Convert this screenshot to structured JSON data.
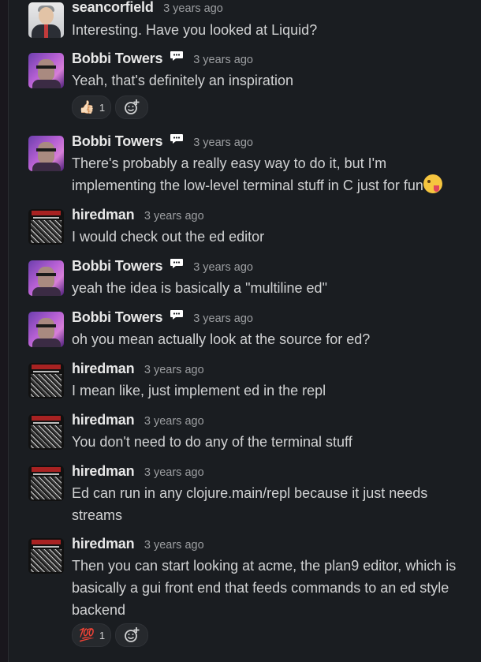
{
  "messages": [
    {
      "author": "seancorfield",
      "time": "3 years ago",
      "text": "Interesting. Have you looked at Liquid?",
      "avatar": "seancorfield-avatar"
    },
    {
      "author": "Bobbi Towers",
      "time": "3 years ago",
      "text": "Yeah, that's definitely an inspiration",
      "status_icon": "speech-bubble-icon",
      "reactions": [
        {
          "emoji": "👍🏻",
          "icon": "thumbs-up-icon",
          "count": "1"
        }
      ]
    },
    {
      "author": "Bobbi Towers",
      "time": "3 years ago",
      "text": "There's probably a really easy way to do it, but I'm implementing the low-level terminal stuff in C just for fun",
      "inline_emoji": "winking-face-tongue-icon"
    },
    {
      "author": "hiredman",
      "time": "3 years ago",
      "text": "I would check out the ed editor"
    },
    {
      "author": "Bobbi Towers",
      "time": "3 years ago",
      "text": "yeah the idea is basically a \"multiline ed\""
    },
    {
      "author": "Bobbi Towers",
      "time": "3 years ago",
      "text": "oh you mean actually look at the source for ed?"
    },
    {
      "author": "hiredman",
      "time": "3 years ago",
      "text": "I mean like, just implement ed in the repl"
    },
    {
      "author": "hiredman",
      "time": "3 years ago",
      "text": "You don't need to do any of the terminal stuff"
    },
    {
      "author": "hiredman",
      "time": "3 years ago",
      "text": "Ed can run in any clojure.main/repl because it just needs streams"
    },
    {
      "author": "hiredman",
      "time": "3 years ago",
      "text": "Then you can start looking at acme, the plan9 editor, which is basically a gui front end that feeds commands to an ed style backend",
      "reactions": [
        {
          "emoji": "💯",
          "icon": "hundred-points-icon",
          "count": "1"
        }
      ]
    }
  ],
  "colors": {
    "background": "#1a1d21",
    "text": "#d1d2d3",
    "muted": "#9c9ea1",
    "reaction_bg": "#26292d"
  }
}
